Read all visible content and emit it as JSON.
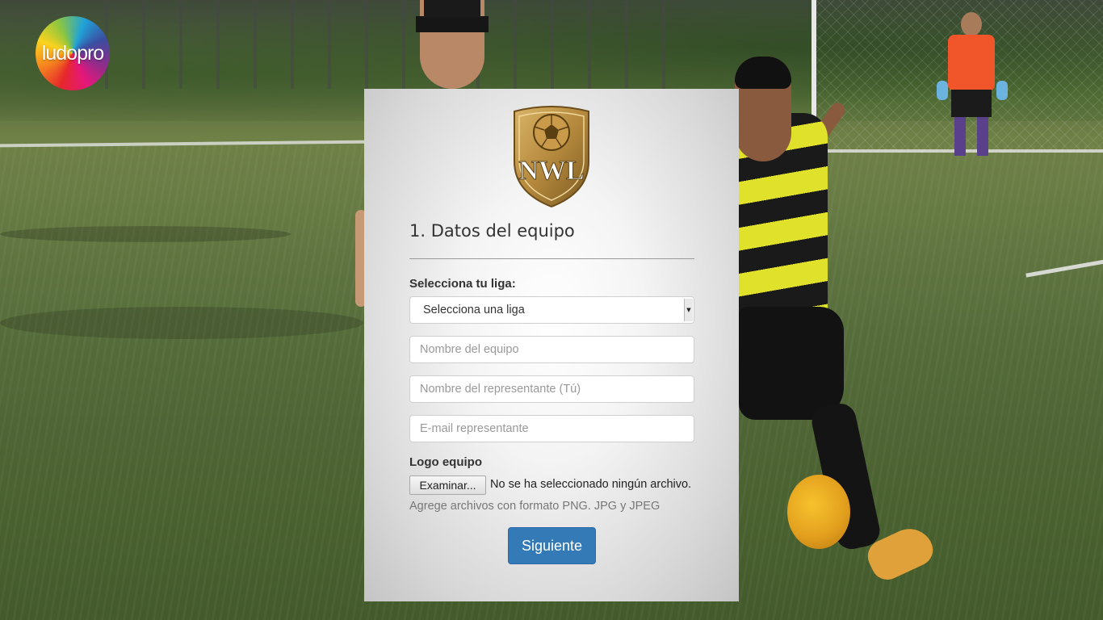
{
  "brand": {
    "logo_text": "ludopro"
  },
  "crest": {
    "text": "NWL",
    "colors": {
      "gold": "#b5893d",
      "dark_gold": "#7a5a22"
    }
  },
  "form": {
    "title": "1. Datos del equipo",
    "league_label": "Selecciona tu liga:",
    "league_select": {
      "selected": "Selecciona una liga"
    },
    "team_name_placeholder": "Nombre del equipo",
    "representative_placeholder": "Nombre del representante (Tú)",
    "email_placeholder": "E-mail representante",
    "logo_label": "Logo equipo",
    "file_button": "Examinar...",
    "file_status": "No se ha seleccionado ningún archivo.",
    "file_help": "Agrege archivos con formato PNG. JPG y JPEG",
    "next_button": "Siguiente"
  },
  "colors": {
    "primary_button": "#337ab7"
  }
}
